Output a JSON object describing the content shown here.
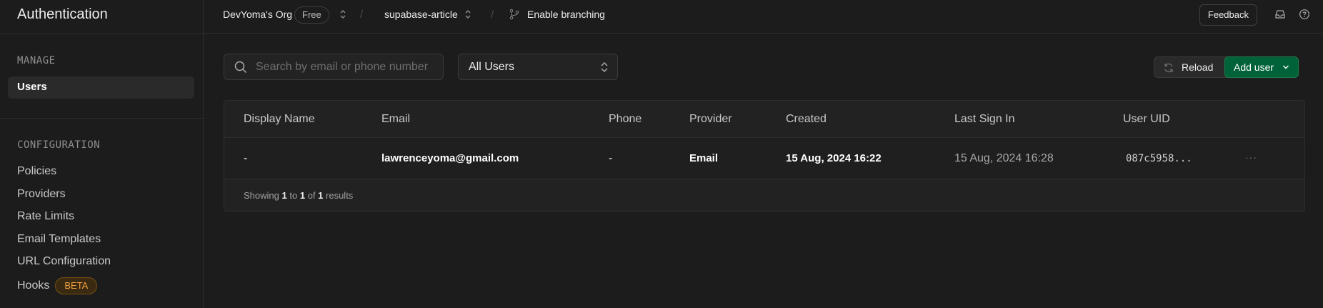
{
  "sidebar": {
    "title": "Authentication",
    "manage_label": "MANAGE",
    "manage_items": [
      {
        "label": "Users",
        "active": true
      }
    ],
    "config_label": "CONFIGURATION",
    "config_items": [
      {
        "label": "Policies"
      },
      {
        "label": "Providers"
      },
      {
        "label": "Rate Limits"
      },
      {
        "label": "Email Templates"
      },
      {
        "label": "URL Configuration"
      },
      {
        "label": "Hooks",
        "badge": "BETA"
      }
    ]
  },
  "topbar": {
    "org": "DevYoma's Org",
    "plan_badge": "Free",
    "project": "supabase-article",
    "branching": "Enable branching",
    "feedback": "Feedback"
  },
  "toolbar": {
    "search_placeholder": "Search by email or phone number",
    "filter_value": "All Users",
    "reload": "Reload",
    "add_user": "Add user"
  },
  "table": {
    "columns": [
      "Display Name",
      "Email",
      "Phone",
      "Provider",
      "Created",
      "Last Sign In",
      "User UID"
    ],
    "rows": [
      {
        "display_name": "-",
        "email": "lawrenceyoma@gmail.com",
        "phone": "-",
        "provider": "Email",
        "created": "15 Aug, 2024 16:22",
        "last_sign_in": "15 Aug, 2024 16:28",
        "uid": "087c5958..."
      }
    ],
    "footer": {
      "prefix": "Showing",
      "from": "1",
      "to_word": "to",
      "to": "1",
      "of_word": "of",
      "total": "1",
      "suffix": "results"
    }
  },
  "colors": {
    "accent": "#006239",
    "beta": "#f1a23c",
    "background": "#1c1c1c"
  },
  "icons": [
    "search-icon",
    "chevron-up-down-icon",
    "branch-icon",
    "inbox-icon",
    "help-icon",
    "reload-icon",
    "chevron-down-icon",
    "more-icon"
  ]
}
